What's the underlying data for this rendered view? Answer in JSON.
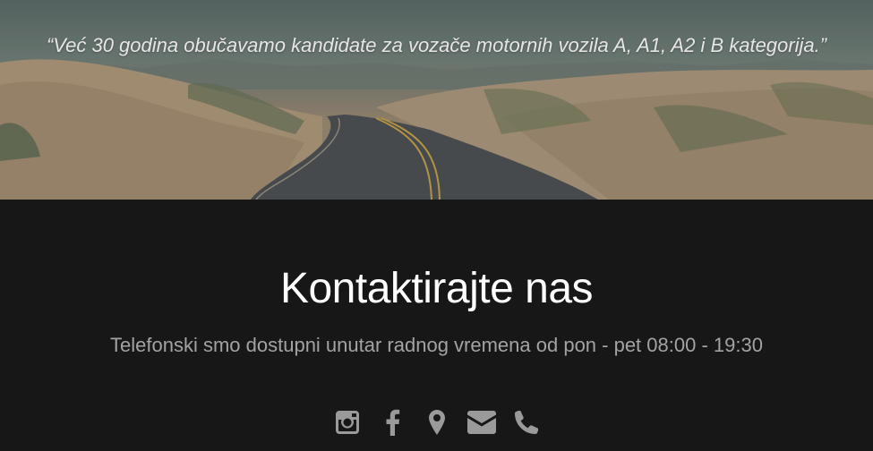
{
  "hero": {
    "quote": "“Već 30 godina obučavamo kandidate za vozače motornih vozila A, A1, A2 i B kategorija.”"
  },
  "contact": {
    "title": "Kontaktirajte nas",
    "subtitle": "Telefonski smo dostupni unutar radnog vremena od pon - pet 08:00 - 19:30"
  },
  "social": [
    {
      "icon": "instagram-icon"
    },
    {
      "icon": "facebook-icon"
    },
    {
      "icon": "map-marker-icon"
    },
    {
      "icon": "envelope-icon"
    },
    {
      "icon": "phone-icon"
    }
  ],
  "colors": {
    "background": "#171717",
    "title": "#ffffff",
    "subtitle": "#a3a3a3",
    "icons": "#9a9a9a"
  }
}
